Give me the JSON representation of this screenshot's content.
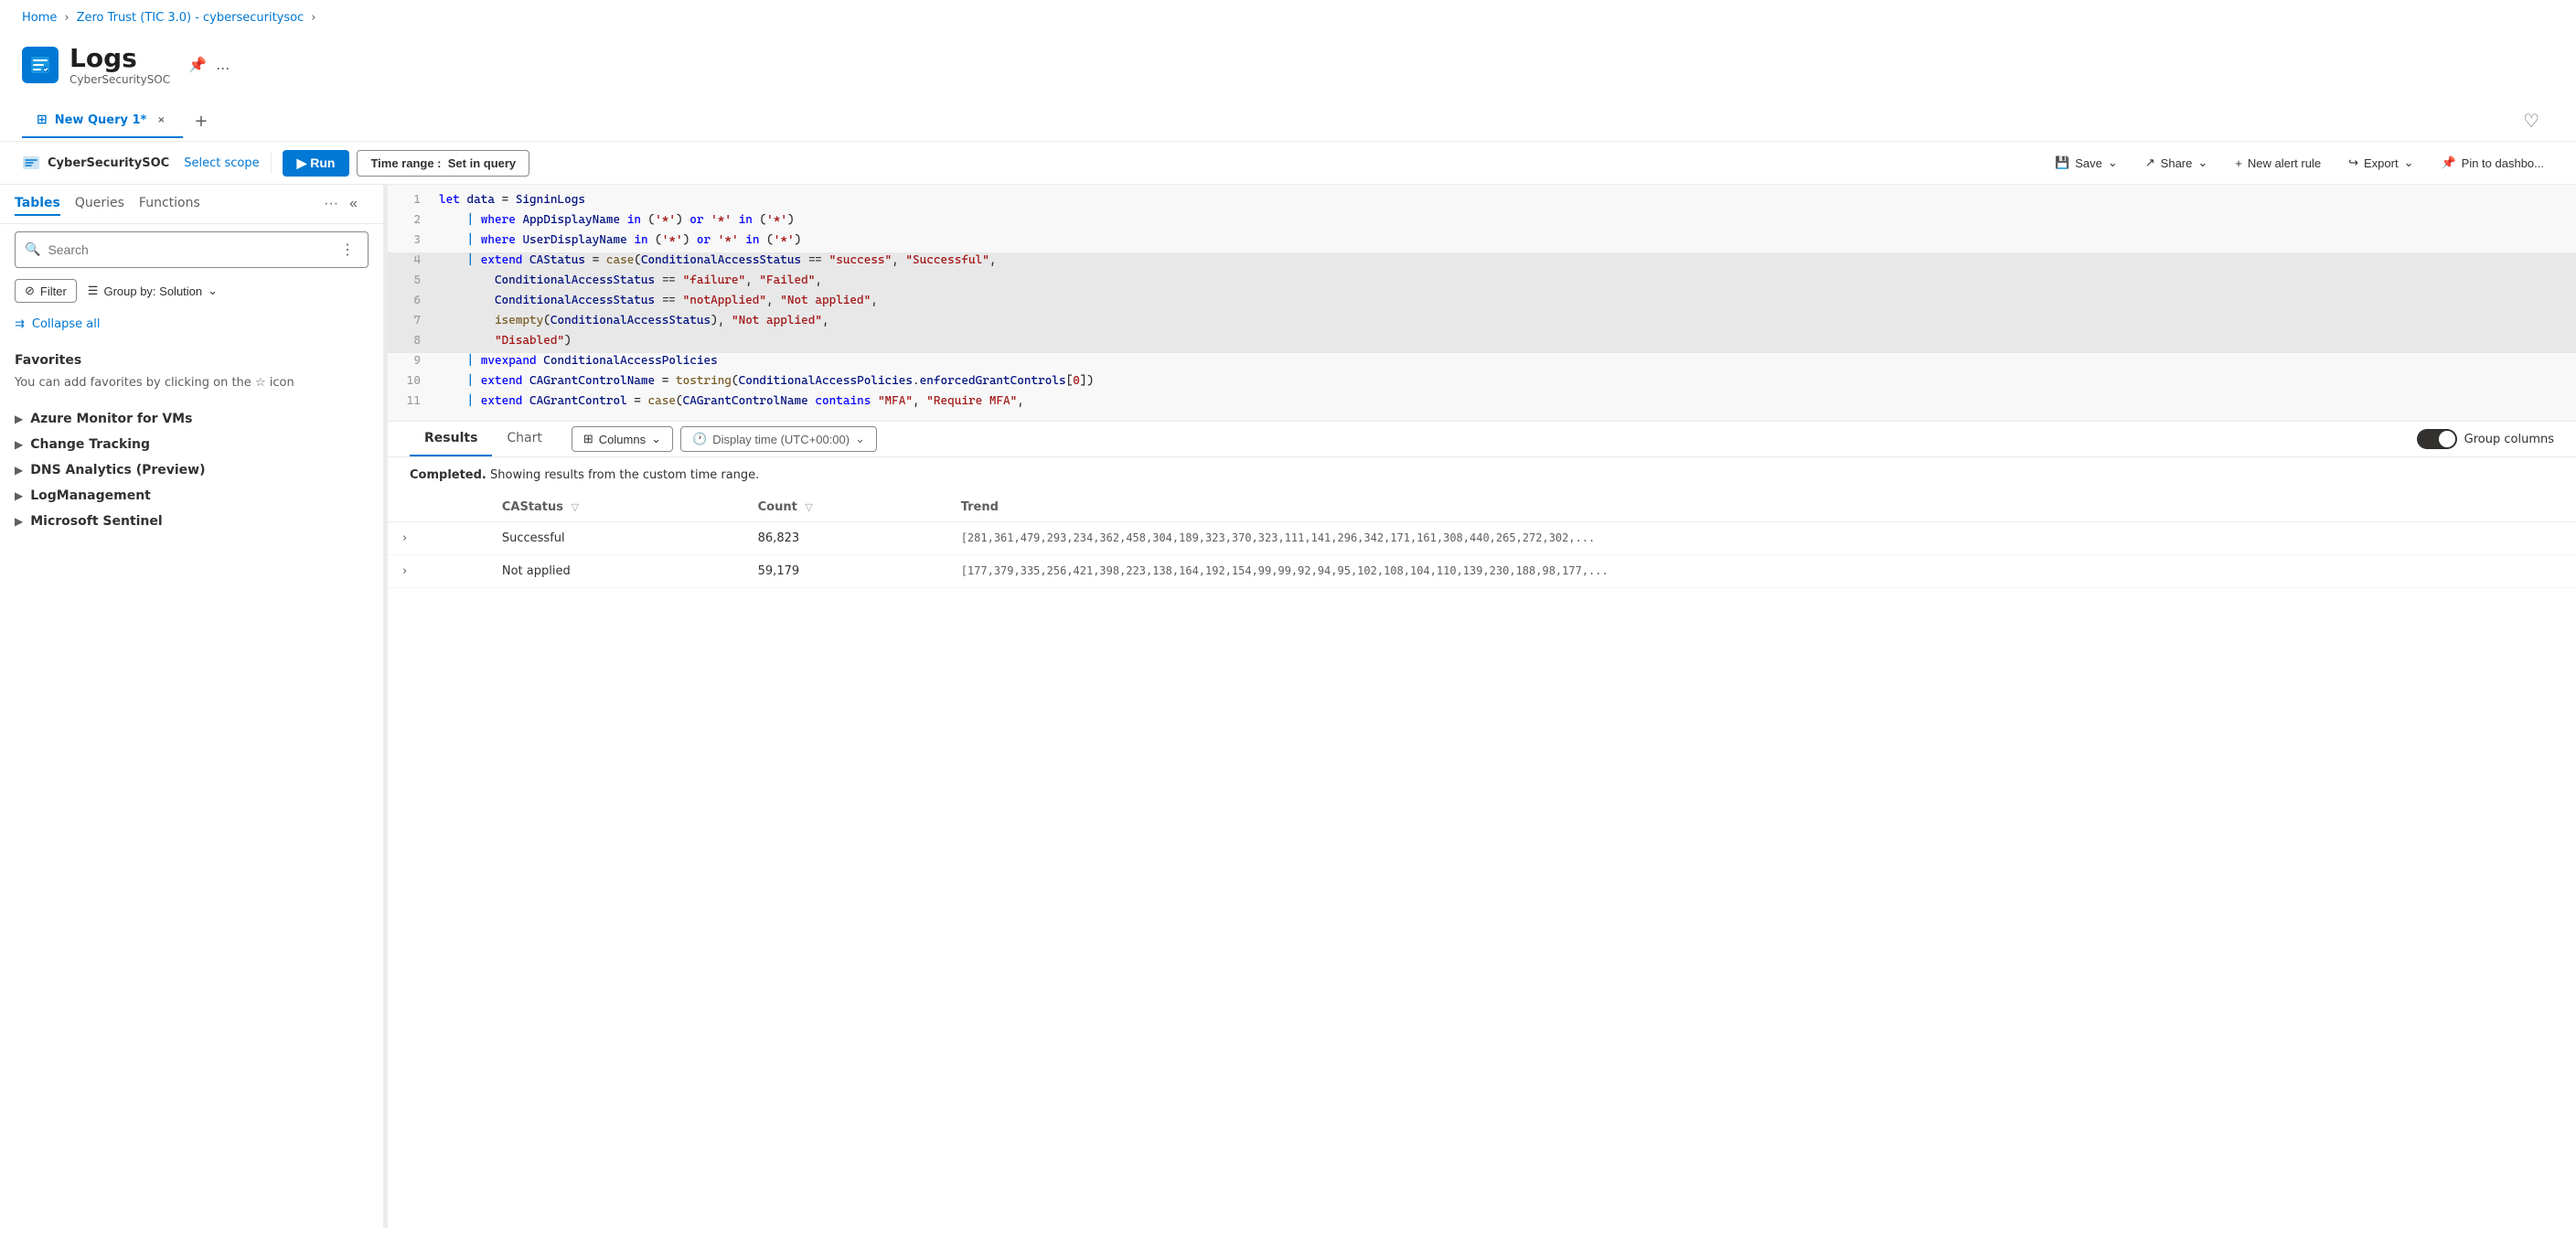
{
  "breadcrumb": {
    "home": "Home",
    "workspace": "Zero Trust (TIC 3.0) - cybersecuritysoc",
    "sep": "›"
  },
  "app": {
    "title": "Logs",
    "subtitle": "CyberSecuritySOC",
    "pin_label": "📌",
    "more_label": "..."
  },
  "tab": {
    "label": "New Query 1*",
    "close": "×",
    "add": "+"
  },
  "toolbar": {
    "scope_label": "CyberSecuritySOC",
    "scope_link": "Select scope",
    "run_label": "▶ Run",
    "time_range_prefix": "Time range :",
    "time_range_value": "Set in query",
    "save_label": "Save",
    "share_label": "Share",
    "new_alert_label": "New alert rule",
    "export_label": "Export",
    "pin_label": "Pin to dashbo..."
  },
  "left_panel": {
    "tabs": [
      "Tables",
      "Queries",
      "Functions"
    ],
    "more_label": "···",
    "collapse_label": "«",
    "search_placeholder": "Search",
    "filter_label": "Filter",
    "group_by_label": "Group by: Solution",
    "collapse_all": "Collapse all",
    "favorites_title": "Favorites",
    "favorites_hint": "You can add favorites by clicking on the",
    "favorites_hint2": "icon",
    "sections": [
      "Azure Monitor for VMs",
      "Change Tracking",
      "DNS Analytics (Preview)",
      "LogManagement",
      "Microsoft Sentinel"
    ]
  },
  "query": {
    "lines": [
      {
        "num": "1",
        "content": "let data = SigninLogs",
        "highlight": false
      },
      {
        "num": "2",
        "content": "    | where AppDisplayName in ('*') or '*' in ('*')",
        "highlight": false
      },
      {
        "num": "3",
        "content": "    | where UserDisplayName in ('*') or '*' in ('*')",
        "highlight": false
      },
      {
        "num": "4",
        "content": "    | extend CAStatus = case(ConditionalAccessStatus == \"success\", \"Successful\",",
        "highlight": true
      },
      {
        "num": "5",
        "content": "        ConditionalAccessStatus == \"failure\", \"Failed\",",
        "highlight": true
      },
      {
        "num": "6",
        "content": "        ConditionalAccessStatus == \"notApplied\", \"Not applied\",",
        "highlight": true
      },
      {
        "num": "7",
        "content": "        isempty(ConditionalAccessStatus), \"Not applied\",",
        "highlight": true
      },
      {
        "num": "8",
        "content": "        \"Disabled\")",
        "highlight": true
      },
      {
        "num": "9",
        "content": "    | mvexpand ConditionalAccessPolicies",
        "highlight": false
      },
      {
        "num": "10",
        "content": "    | extend CAGrantControlName = tostring(ConditionalAccessPolicies.enforcedGrantControls[0])",
        "highlight": false
      },
      {
        "num": "11",
        "content": "    | extend CAGrantControl = case(CAGrantControlName contains \"MFA\", \"Require MFA\",",
        "highlight": false
      }
    ]
  },
  "results": {
    "tabs": [
      "Results",
      "Chart"
    ],
    "columns_label": "Columns",
    "display_time_label": "Display time (UTC+00:00)",
    "group_columns_label": "Group columns",
    "status_message": "Completed.",
    "status_detail": "Showing results from the custom time range.",
    "columns": [
      "CAStatus",
      "Count",
      "Trend"
    ],
    "rows": [
      {
        "expand": "›",
        "castatus": "Successful",
        "count": "86,823",
        "trend": "[281,361,479,293,234,362,458,304,189,323,370,323,111,141,296,342,171,161,308,440,265,272,302,..."
      },
      {
        "expand": "›",
        "castatus": "Not applied",
        "count": "59,179",
        "trend": "[177,379,335,256,421,398,223,138,164,192,154,99,99,92,94,95,102,108,104,110,139,230,188,98,177,..."
      }
    ]
  }
}
